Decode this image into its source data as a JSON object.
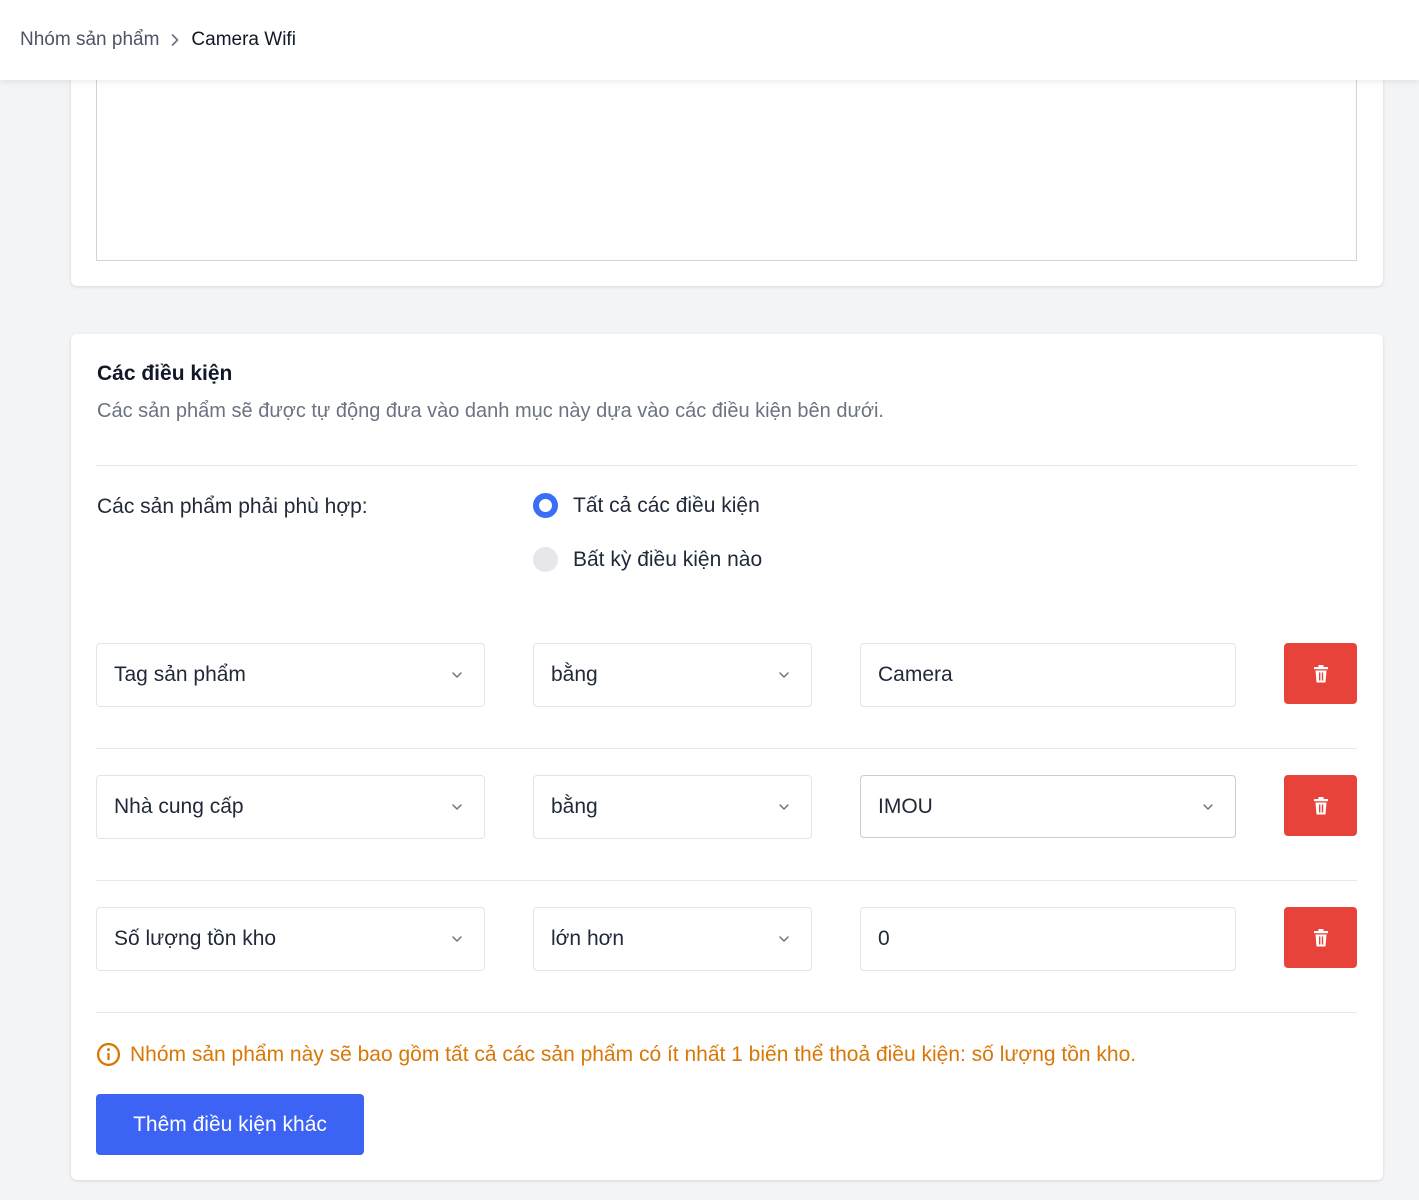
{
  "breadcrumb": {
    "parent": "Nhóm sản phẩm",
    "current": "Camera Wifi"
  },
  "conditions": {
    "title": "Các điều kiện",
    "description": "Các sản phẩm sẽ được tự động đưa vào danh mục này dựa vào các điều kiện bên dưới.",
    "match_label": "Các sản phẩm phải phù hợp:",
    "match_options": [
      {
        "label": "Tất cả các điều kiện",
        "selected": true
      },
      {
        "label": "Bất kỳ điều kiện nào",
        "selected": false
      }
    ],
    "rows": [
      {
        "field": "Tag sản phẩm",
        "operator": "bằng",
        "value": "Camera",
        "value_type": "input"
      },
      {
        "field": "Nhà cung cấp",
        "operator": "bằng",
        "value": "IMOU",
        "value_type": "select"
      },
      {
        "field": "Số lượng tồn kho",
        "operator": "lớn hơn",
        "value": "0",
        "value_type": "input"
      }
    ],
    "warning": "Nhóm sản phẩm này sẽ bao gồm tất cả các sản phẩm có ít nhất 1 biến thể thoả điều kiện: số lượng tồn kho.",
    "add_button": "Thêm điều kiện khác"
  },
  "icons": {
    "breadcrumb_separator": "chevron-right-icon",
    "select_arrow": "chevron-down-icon",
    "delete": "trash-icon",
    "warning": "info-circle-icon",
    "radio_selected": "radio-checked",
    "radio_unselected": "radio-unchecked"
  },
  "colors": {
    "primary": "#3d63f4",
    "radio": "#3b6ef6",
    "danger": "#e8433b",
    "warning": "#d97706",
    "muted_text": "#6b7280"
  }
}
